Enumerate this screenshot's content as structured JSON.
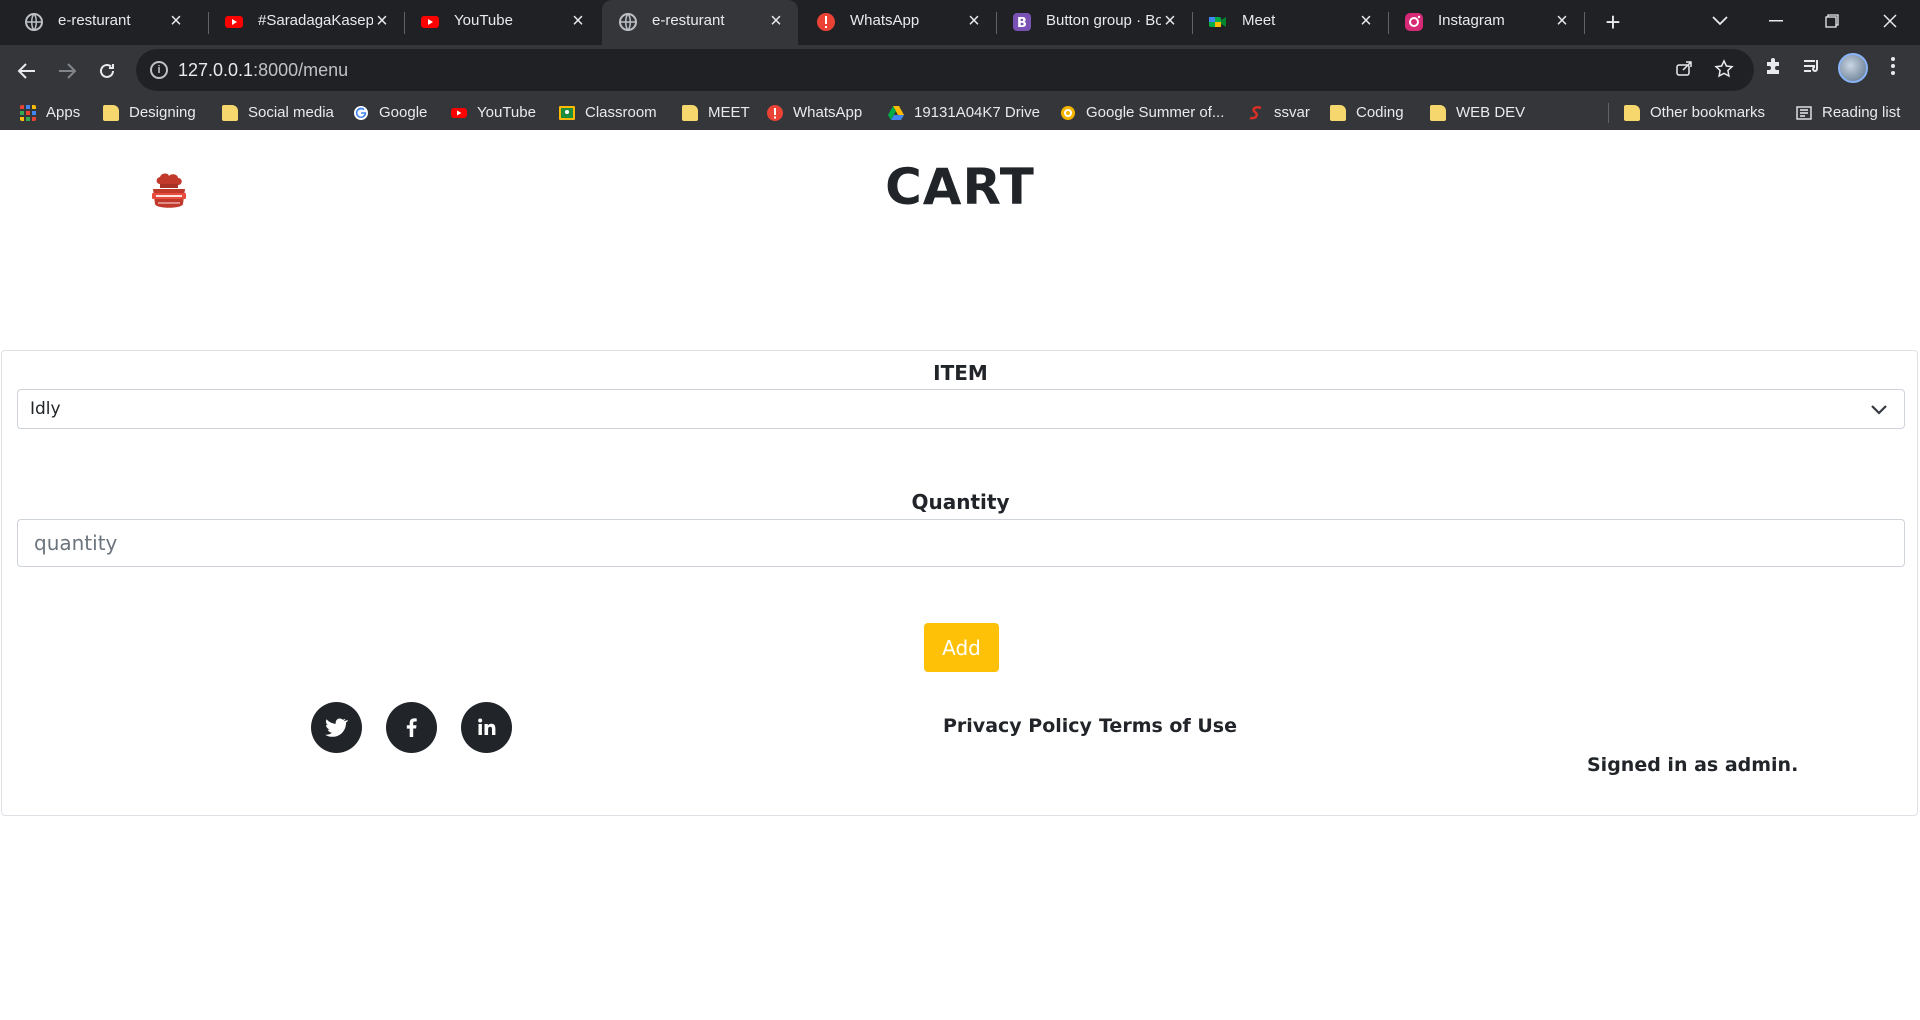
{
  "browser": {
    "tabs": [
      {
        "title": "e-resturant",
        "icon": "globe-icon",
        "active": false
      },
      {
        "title": "#SaradagaKasepaina",
        "icon": "youtube-icon",
        "active": false
      },
      {
        "title": "YouTube",
        "icon": "youtube-icon",
        "active": false
      },
      {
        "title": "e-resturant",
        "icon": "globe-icon",
        "active": true
      },
      {
        "title": "WhatsApp",
        "icon": "whatsapp-icon",
        "active": false
      },
      {
        "title": "Button group · Bootstrap",
        "icon": "bootstrap-icon",
        "active": false
      },
      {
        "title": "Meet",
        "icon": "meet-icon",
        "active": false
      },
      {
        "title": "Instagram",
        "icon": "instagram-icon",
        "active": false
      }
    ],
    "address": {
      "host": "127.0.0.1",
      "rest": ":8000/menu"
    },
    "bookmarks": [
      {
        "label": "Apps",
        "icon": "apps-grid-icon"
      },
      {
        "label": "Designing",
        "icon": "folder-icon"
      },
      {
        "label": "Social media",
        "icon": "folder-icon"
      },
      {
        "label": "Google",
        "icon": "google-icon"
      },
      {
        "label": "YouTube",
        "icon": "youtube-icon"
      },
      {
        "label": "Classroom",
        "icon": "classroom-icon"
      },
      {
        "label": "MEET",
        "icon": "folder-icon"
      },
      {
        "label": "WhatsApp",
        "icon": "whatsapp-icon"
      },
      {
        "label": "19131A04K7 Drive",
        "icon": "drive-icon"
      },
      {
        "label": "Google Summer of...",
        "icon": "gsoc-icon"
      },
      {
        "label": "ssvar",
        "icon": "ssvar-icon"
      },
      {
        "label": "Coding",
        "icon": "folder-icon"
      },
      {
        "label": "WEB DEV",
        "icon": "folder-icon"
      },
      {
        "label": "Other bookmarks",
        "icon": "folder-icon"
      },
      {
        "label": "Reading list",
        "icon": "reading-list-icon"
      }
    ]
  },
  "page": {
    "title": "CART",
    "form": {
      "item_label": "ITEM",
      "item_selected": "Idly",
      "quantity_label": "Quantity",
      "quantity_value": "",
      "quantity_placeholder": "quantity",
      "add_button": "Add"
    },
    "footer": {
      "social": [
        "twitter-icon",
        "facebook-icon",
        "linkedin-icon"
      ],
      "privacy_link": "Privacy Policy",
      "terms_link": "Terms of Use",
      "signed_in": "Signed in as admin."
    }
  },
  "colors": {
    "accent_button": "#ffc107",
    "dark": "#212529",
    "chrome_dark": "#202124",
    "chrome_toolbar": "#35363a"
  }
}
